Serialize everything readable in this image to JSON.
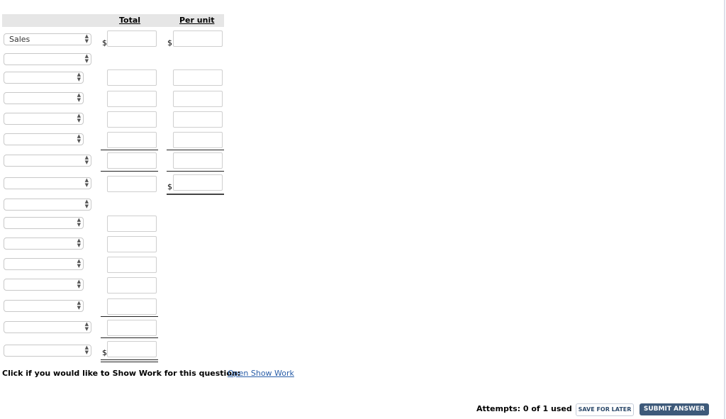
{
  "header": {
    "total_label": "Total",
    "per_unit_label": "Per unit"
  },
  "currency_symbol": "$",
  "rows": [
    {
      "select_value": "Sales"
    },
    {
      "select_value": ""
    },
    {
      "select_value": ""
    },
    {
      "select_value": ""
    },
    {
      "select_value": ""
    },
    {
      "select_value": ""
    },
    {
      "select_value": ""
    },
    {
      "select_value": ""
    },
    {
      "select_value": ""
    },
    {
      "select_value": ""
    },
    {
      "select_value": ""
    },
    {
      "select_value": ""
    },
    {
      "select_value": ""
    },
    {
      "select_value": ""
    },
    {
      "select_value": ""
    },
    {
      "select_value": ""
    }
  ],
  "show_work": {
    "prompt": "Click if you would like to Show Work for this question:",
    "link_label": "Open Show Work"
  },
  "footer": {
    "attempts": "Attempts: 0 of 1 used",
    "save_label": "SAVE FOR LATER",
    "submit_label": "SUBMIT ANSWER"
  },
  "icons": {
    "select_arrow": "updown-arrows-icon"
  }
}
